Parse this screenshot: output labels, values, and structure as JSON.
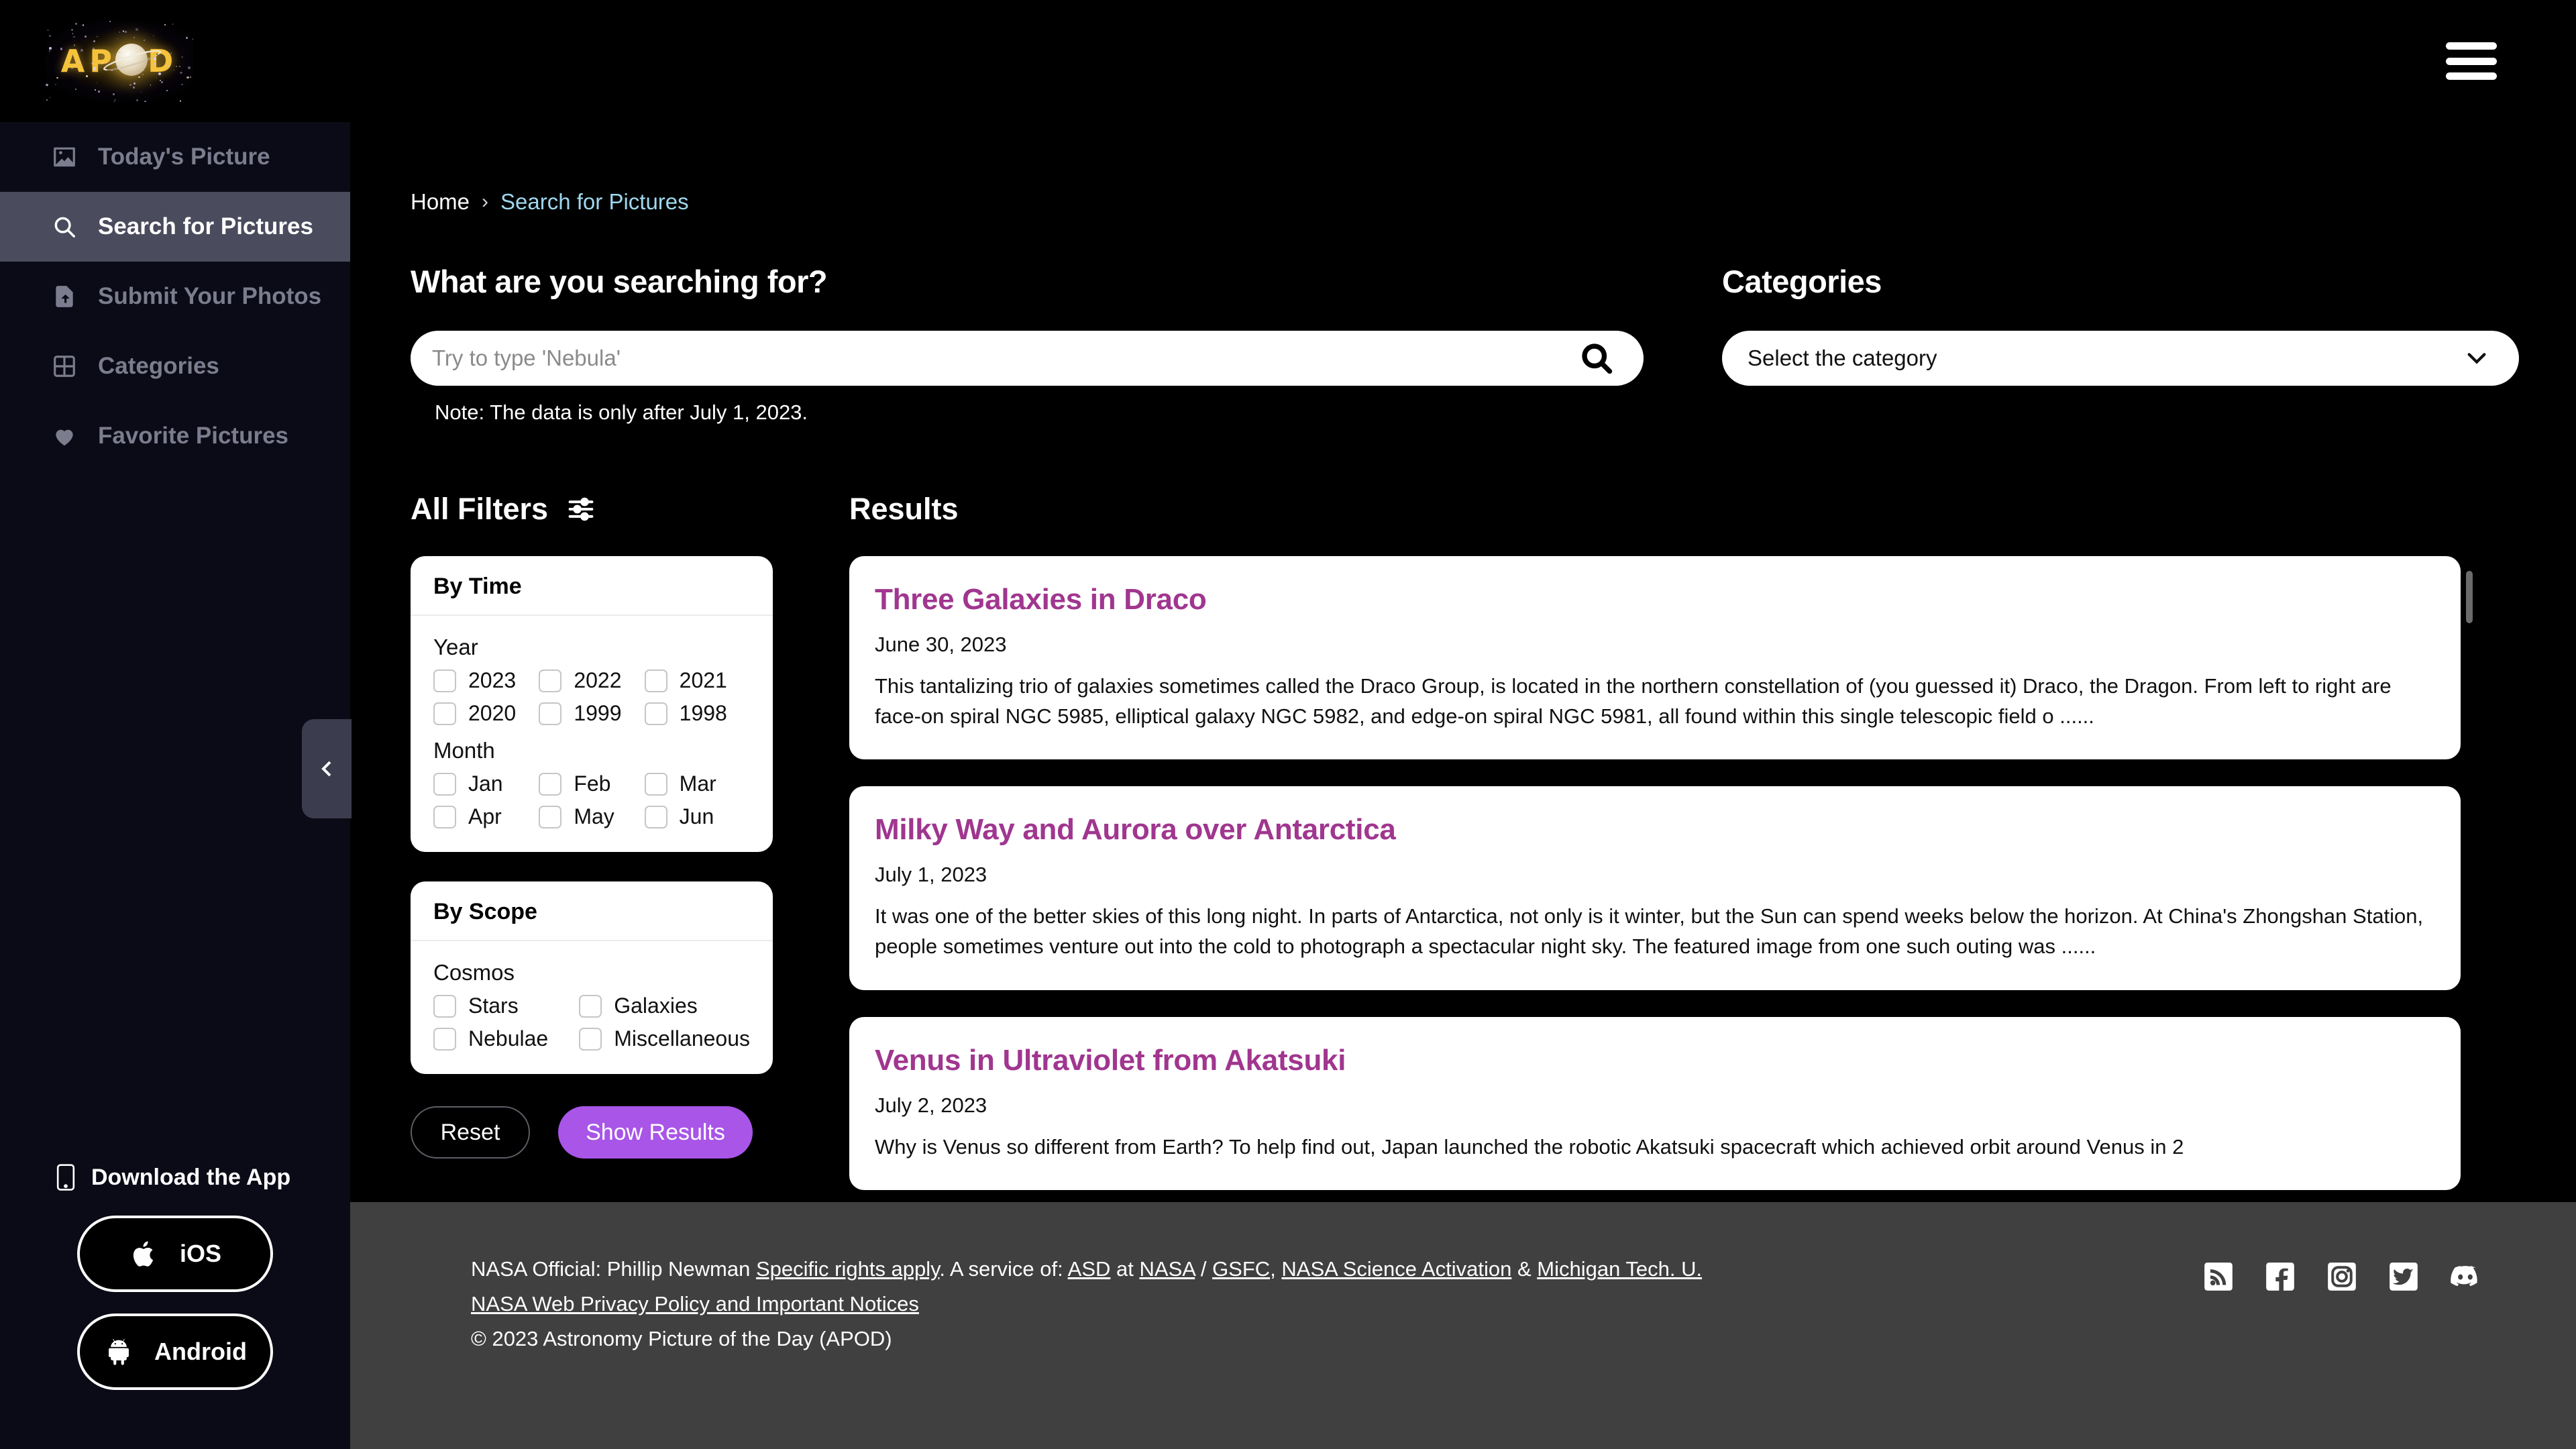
{
  "header": {
    "logo_text": "APOD",
    "menu_icon": "hamburger-icon"
  },
  "sidebar": {
    "items": [
      {
        "label": "Today's Picture",
        "icon": "image-icon",
        "active": false
      },
      {
        "label": "Search for Pictures",
        "icon": "search-icon",
        "active": true
      },
      {
        "label": "Submit Your Photos",
        "icon": "upload-file-icon",
        "active": false
      },
      {
        "label": "Categories",
        "icon": "grid-icon",
        "active": false
      },
      {
        "label": "Favorite Pictures",
        "icon": "heart-icon",
        "active": false
      }
    ],
    "download": {
      "title": "Download the App",
      "ios_label": "iOS",
      "android_label": "Android"
    },
    "collapse_icon": "chevron-left-icon"
  },
  "breadcrumb": {
    "home": "Home",
    "separator": "›",
    "current": "Search for Pictures"
  },
  "search": {
    "title": "What are you searching for?",
    "placeholder": "Try to type 'Nebula'",
    "value": "",
    "note": "Note: The data is only after July 1, 2023.",
    "icon": "search-icon"
  },
  "categories": {
    "title": "Categories",
    "selected": "Select the category",
    "icon": "chevron-down-icon"
  },
  "filters": {
    "title": "All Filters",
    "icon": "sliders-icon",
    "by_time": {
      "title": "By Time",
      "year_label": "Year",
      "years": [
        "2023",
        "2022",
        "2021",
        "2020",
        "1999",
        "1998"
      ],
      "month_label": "Month",
      "months": [
        "Jan",
        "Feb",
        "Mar",
        "Apr",
        "May",
        "Jun"
      ]
    },
    "by_scope": {
      "title": "By Scope",
      "cosmos_label": "Cosmos",
      "options": [
        "Stars",
        "Galaxies",
        "Nebulae",
        "Miscellaneous"
      ]
    },
    "reset_label": "Reset",
    "show_results_label": "Show Results",
    "accent_color": "#a855e8"
  },
  "results": {
    "title": "Results",
    "title_color": "#a0368f",
    "items": [
      {
        "title": "Three Galaxies in Draco",
        "date": "June 30, 2023",
        "description": "This tantalizing trio of galaxies sometimes called the Draco Group, is located in the northern constellation of (you guessed it) Draco, the Dragon. From left to right are face-on spiral NGC 5985, elliptical galaxy NGC 5982, and edge-on spiral NGC 5981, all found within this single telescopic field o ......"
      },
      {
        "title": "Milky Way and Aurora over Antarctica",
        "date": "July 1, 2023",
        "description": "It was one of the better skies of this long night. In parts of Antarctica, not only is it winter, but the Sun can spend weeks below the horizon. At China's Zhongshan Station, people sometimes venture out into the cold to photograph a spectacular night sky. The featured image from one such outing was ......"
      },
      {
        "title": "Venus in Ultraviolet from Akatsuki",
        "date": "July 2, 2023",
        "description": "Why is Venus so different from Earth? To help find out, Japan launched the robotic Akatsuki spacecraft which achieved orbit around Venus in 2"
      }
    ]
  },
  "footer": {
    "line1_prefix": "NASA Official: Phillip Newman ",
    "line1_link1": "Specific rights apply",
    "line1_mid": ". A service of: ",
    "line1_link2": "ASD",
    "line1_at": " at ",
    "line1_link3": "NASA",
    "line1_slash": " / ",
    "line1_link4": "GSFC",
    "line1_comma": ", ",
    "line1_link5": "NASA Science Activation",
    "line1_amp": " & ",
    "line1_link6": "Michigan Tech. U.",
    "line2": "NASA Web Privacy Policy and Important Notices",
    "line3": "© 2023 Astronomy Picture of the Day (APOD)",
    "social": [
      "rss-icon",
      "facebook-icon",
      "instagram-icon",
      "twitter-icon",
      "discord-icon"
    ]
  }
}
